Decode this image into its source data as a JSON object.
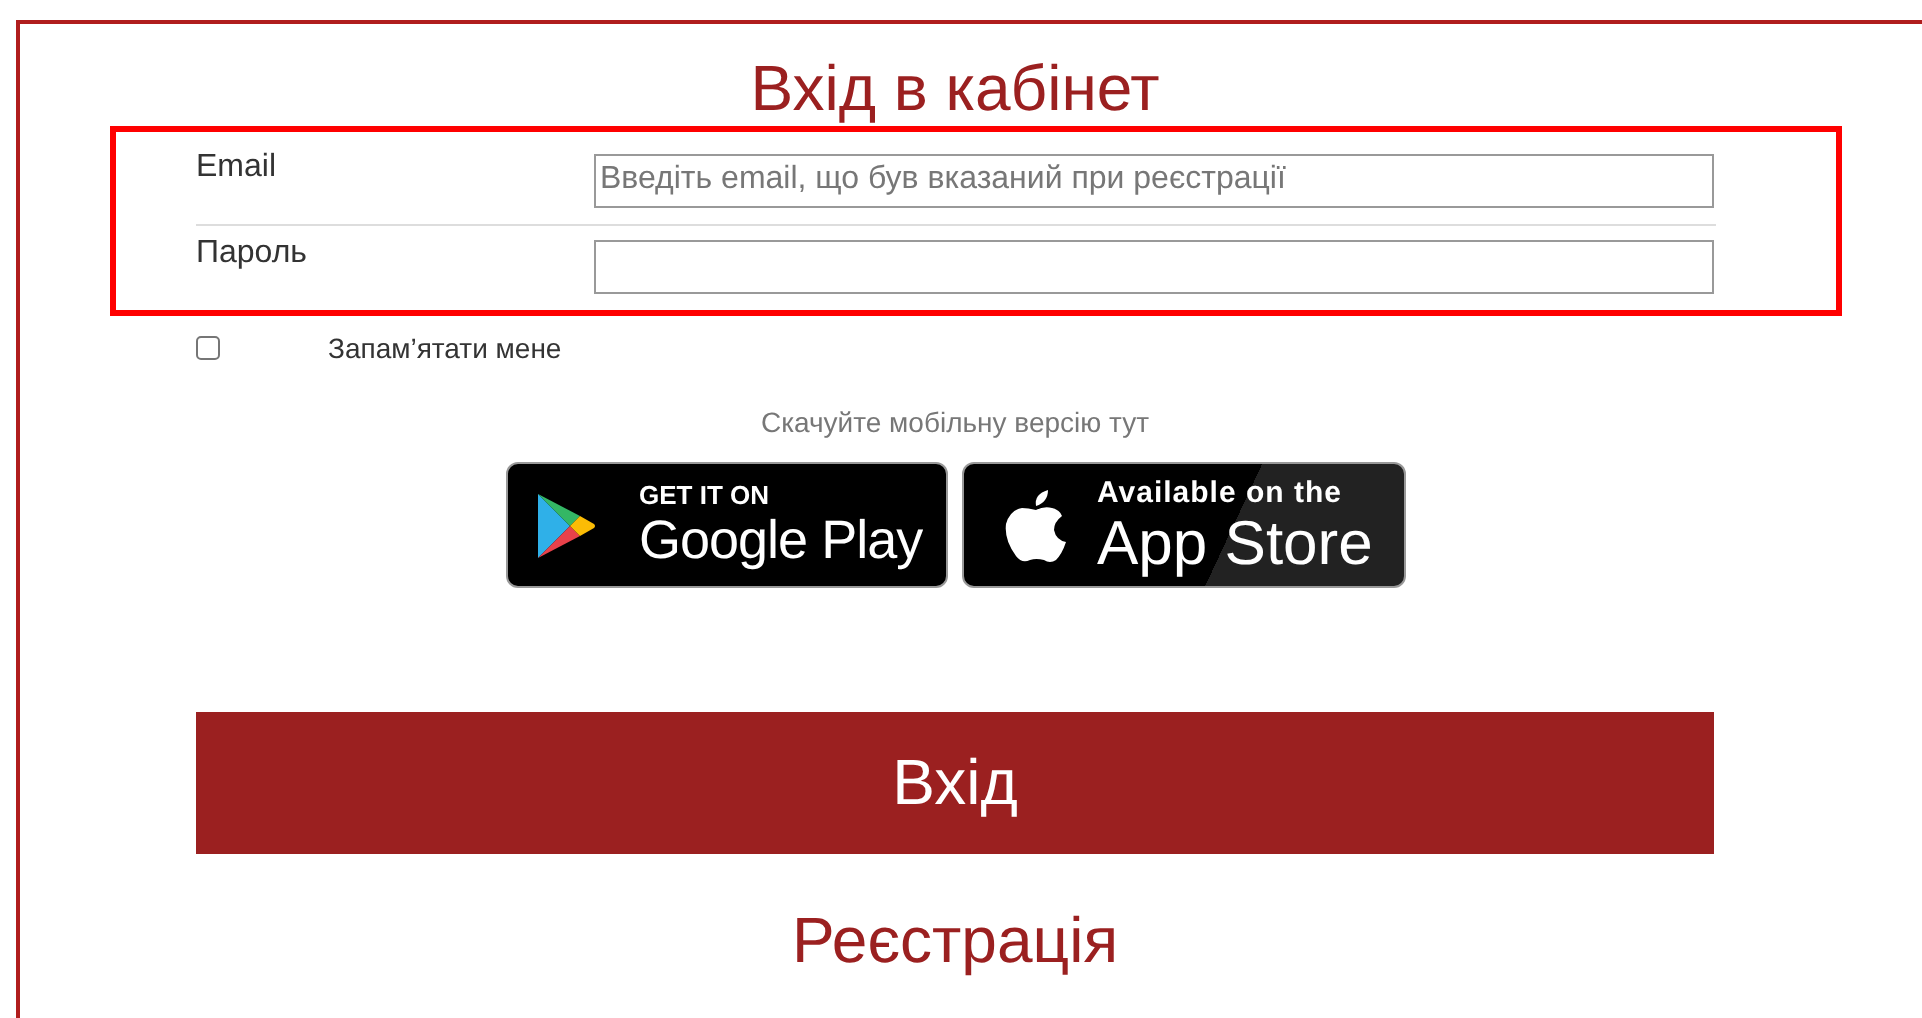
{
  "title": "Вхід в кабінет",
  "fields": [
    {
      "label": "Email",
      "placeholder": "Введіть email, що був вказаний при реєстрації"
    },
    {
      "label": "Пароль"
    }
  ],
  "remember": {
    "label": "Запам’ятати мене",
    "checked": false
  },
  "download_text": "Скачуйте мобільну версію тут",
  "stores": [
    {
      "kind": "google",
      "small": "GET IT ON",
      "big": "Google Play"
    },
    {
      "kind": "apple",
      "small": "Available on the",
      "big": "App Store"
    }
  ],
  "submit": "Вхід",
  "register": "Реєстрація"
}
